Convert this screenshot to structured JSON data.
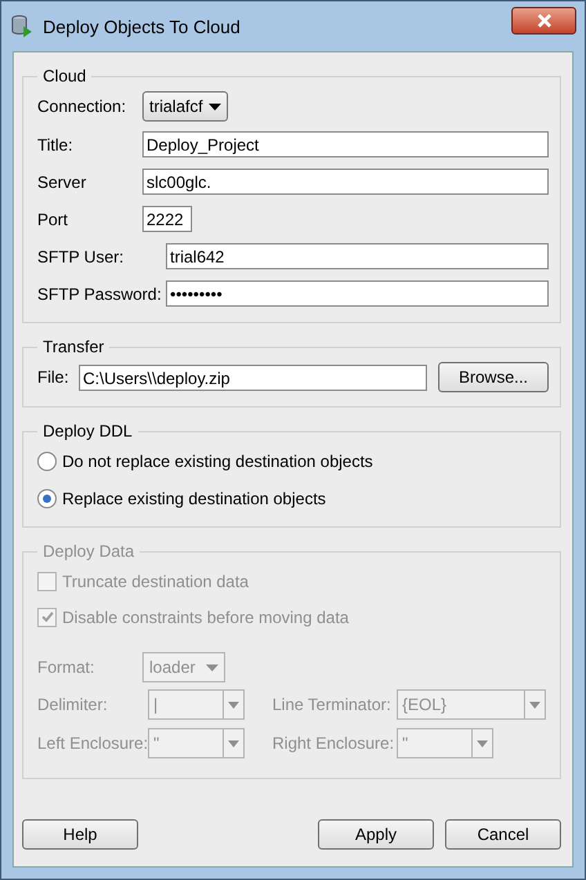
{
  "window": {
    "title": "Deploy Objects To Cloud"
  },
  "cloud": {
    "legend": "Cloud",
    "fields": [
      {
        "kind": "dropdown",
        "label": "Connection:",
        "value": "trialafcf"
      },
      {
        "kind": "text",
        "label": "Title:",
        "value": "Deploy_Project"
      },
      {
        "kind": "text",
        "label": "Server",
        "value": "slc00glc."
      },
      {
        "kind": "number",
        "label": "Port",
        "value": "2222"
      },
      {
        "kind": "credential",
        "label": "SFTP User:",
        "value": "trial642"
      },
      {
        "kind": "secret",
        "label": "SFTP Password:",
        "value": "•••••••••"
      }
    ]
  },
  "transfer": {
    "legend": "Transfer",
    "label": "File:",
    "value": "C:\\Users\\\\deploy.zip",
    "button": "Browse..."
  },
  "deploy_ddl": {
    "legend": "Deploy DDL",
    "options": [
      {
        "label": "Do not replace existing destination objects",
        "selected": false
      },
      {
        "label": "Replace existing destination objects",
        "selected": true
      }
    ]
  },
  "deploy_data": {
    "legend": "Deploy Data",
    "disabled": true,
    "checkboxes": [
      {
        "label": "Truncate destination data",
        "checked": false
      },
      {
        "label": "Disable constraints before moving data",
        "checked": true
      }
    ],
    "format": {
      "label": "Format:",
      "value": "loader"
    },
    "combos": [
      {
        "label": "Delimiter:",
        "value": "|"
      },
      {
        "label": "Line Terminator:",
        "value": "{EOL}"
      },
      {
        "label": "Left Enclosure:",
        "value": "\""
      },
      {
        "label": "Right Enclosure:",
        "value": "\""
      }
    ]
  },
  "buttons": {
    "left": [
      "Help"
    ],
    "right": [
      "Apply",
      "Cancel"
    ]
  }
}
